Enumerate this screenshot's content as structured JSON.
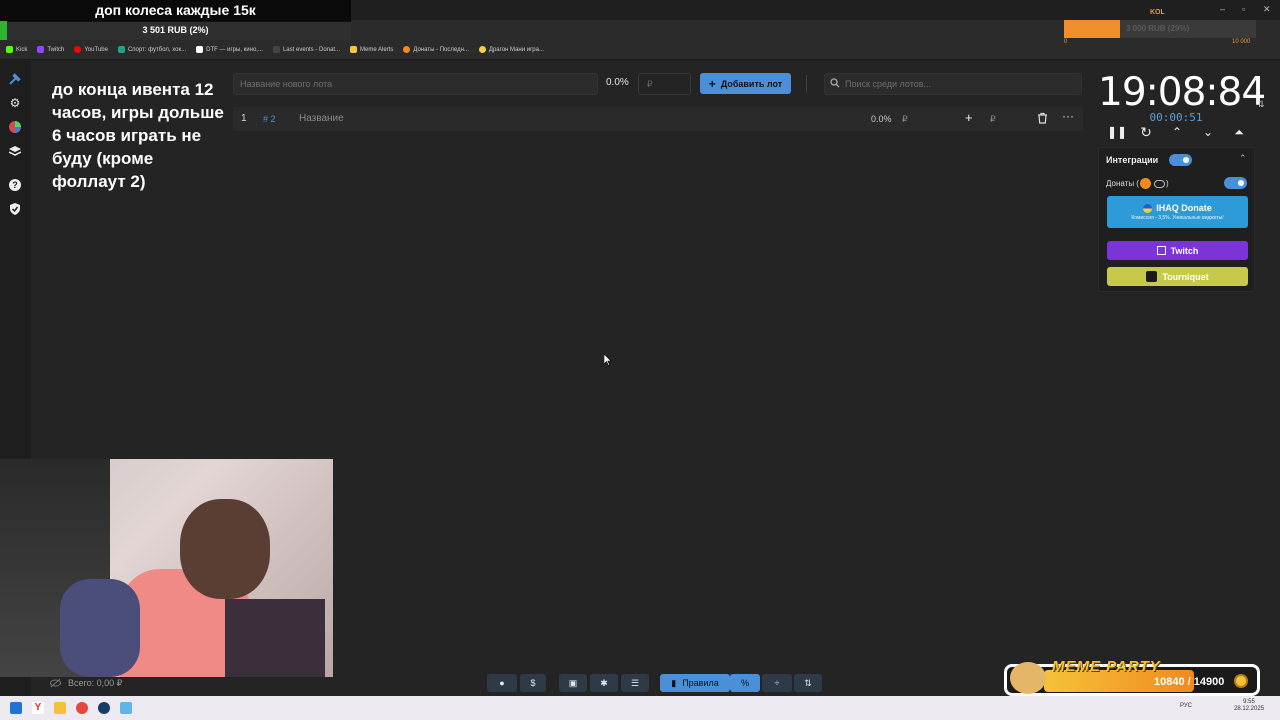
{
  "stream_overlay": {
    "banner": "доп колеса каждые 15к",
    "donation_bar_text": "3 501 RUB (2%)",
    "note": "до конца ивента 12 часов, игры дольше 6 часов играть не буду (кроме фоллаут 2)"
  },
  "kol_overlay": {
    "label": "KOL",
    "bar_text": "3 000 RUB (29%)",
    "min": "0",
    "max": "10 000",
    "progress_fraction": 0.29
  },
  "browser": {
    "bookmarks": [
      {
        "label": "Kick",
        "color": "#53fc18"
      },
      {
        "label": "Twitch",
        "color": "#9146ff"
      },
      {
        "label": "YouTube",
        "color": "#ff0000"
      },
      {
        "label": "Спорт: футбол, хок...",
        "color": "#1fa38c"
      },
      {
        "label": "DTF — игры, кино,...",
        "color": "#ffffff"
      },
      {
        "label": "Last events - Donat...",
        "color": "#444444"
      },
      {
        "label": "Meme Alerts",
        "color": "#f5c542"
      },
      {
        "label": "Донаты - Последн...",
        "color": "#f58a1f"
      },
      {
        "label": "Драгон Мани игра...",
        "color": "#f5d142"
      }
    ]
  },
  "lot_form": {
    "name_placeholder": "Название нового лота",
    "percent": "0.0%",
    "amount_placeholder": "₽",
    "add_button": "Добавить лот",
    "search_placeholder": "Поиск среди лотов..."
  },
  "lots": [
    {
      "index": "1",
      "id": "# 2",
      "name": "Название",
      "percent": "0.0%",
      "currency": "₽"
    }
  ],
  "timer": {
    "main": "19:08:84",
    "sub": "00:00:51"
  },
  "integrations": {
    "title": "Интеграции",
    "donations_label": "Донаты (",
    "donations_suffix": ")",
    "ihaq_title": "IHAQ Donate",
    "ihaq_subtitle": "Комиссия - 3,5%. Уникальные виджеты!",
    "twitch": "Twitch",
    "tourniquet": "Tourniquet",
    "colors": {
      "ihaq": "#2d9bd8",
      "twitch": "#7b34d8",
      "tourniquet": "#c6c94a"
    }
  },
  "footer": {
    "total": "Всего: 0,00 ₽",
    "rules_button": "Правила"
  },
  "meme_party": {
    "title": "MEME PARTY",
    "value": "10840 / 14900"
  },
  "taskbar": {
    "lang": "РУС",
    "time": "9:55",
    "date": "28.12.2025"
  },
  "cursor": {
    "visible": true
  }
}
